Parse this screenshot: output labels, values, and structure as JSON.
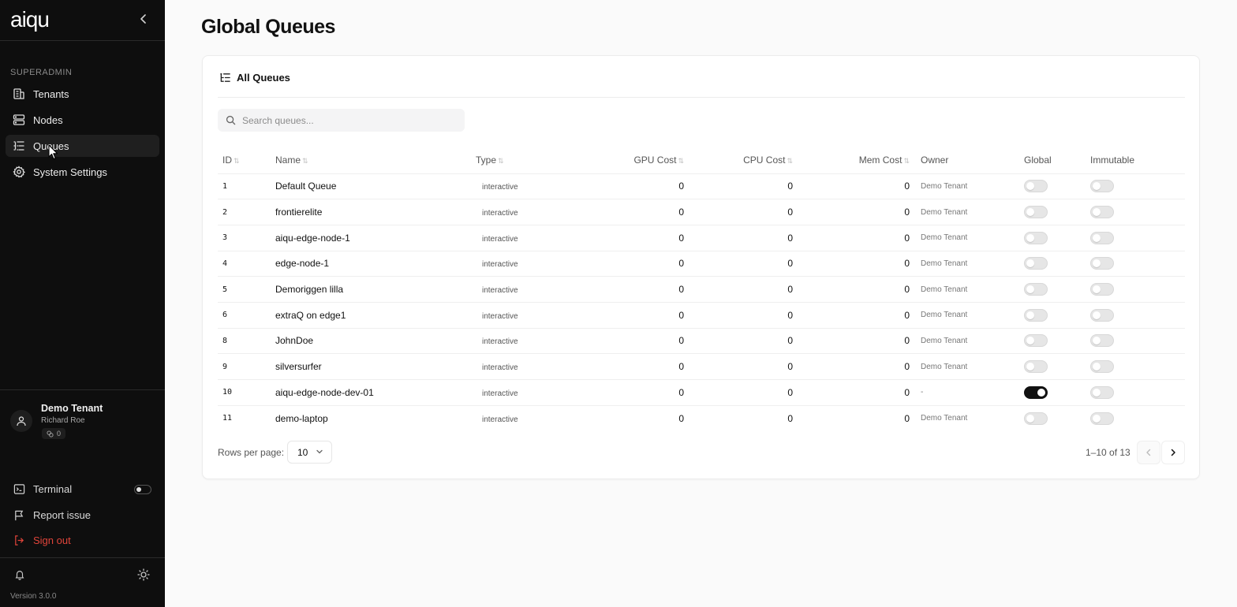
{
  "sidebar": {
    "logo": "aiqu",
    "section_label": "SUPERADMIN",
    "items": [
      {
        "label": "Tenants",
        "icon": "building-icon"
      },
      {
        "label": "Nodes",
        "icon": "server-icon"
      },
      {
        "label": "Queues",
        "icon": "list-icon",
        "active": true
      },
      {
        "label": "System Settings",
        "icon": "gear-icon"
      }
    ],
    "user": {
      "tenant": "Demo Tenant",
      "name": "Richard Roe",
      "badge": "0"
    },
    "bottom": {
      "terminal": "Terminal",
      "report": "Report issue",
      "signout": "Sign out"
    },
    "version": "Version 3.0.0"
  },
  "page": {
    "title": "Global Queues"
  },
  "card": {
    "title": "All Queues",
    "search_placeholder": "Search queues..."
  },
  "table": {
    "headers": {
      "id": "ID",
      "name": "Name",
      "type": "Type",
      "gpu": "GPU Cost",
      "cpu": "CPU Cost",
      "mem": "Mem Cost",
      "owner": "Owner",
      "global": "Global",
      "immutable": "Immutable"
    },
    "rows": [
      {
        "id": "1",
        "name": "Default Queue",
        "type": "interactive",
        "gpu": "0",
        "cpu": "0",
        "mem": "0",
        "owner": "Demo Tenant",
        "global": false,
        "immutable": false
      },
      {
        "id": "2",
        "name": "frontierelite",
        "type": "interactive",
        "gpu": "0",
        "cpu": "0",
        "mem": "0",
        "owner": "Demo Tenant",
        "global": false,
        "immutable": false
      },
      {
        "id": "3",
        "name": "aiqu-edge-node-1",
        "type": "interactive",
        "gpu": "0",
        "cpu": "0",
        "mem": "0",
        "owner": "Demo Tenant",
        "global": false,
        "immutable": false
      },
      {
        "id": "4",
        "name": "edge-node-1",
        "type": "interactive",
        "gpu": "0",
        "cpu": "0",
        "mem": "0",
        "owner": "Demo Tenant",
        "global": false,
        "immutable": false
      },
      {
        "id": "5",
        "name": "Demoriggen lilla",
        "type": "interactive",
        "gpu": "0",
        "cpu": "0",
        "mem": "0",
        "owner": "Demo Tenant",
        "global": false,
        "immutable": false
      },
      {
        "id": "6",
        "name": "extraQ on edge1",
        "type": "interactive",
        "gpu": "0",
        "cpu": "0",
        "mem": "0",
        "owner": "Demo Tenant",
        "global": false,
        "immutable": false
      },
      {
        "id": "8",
        "name": "JohnDoe",
        "type": "interactive",
        "gpu": "0",
        "cpu": "0",
        "mem": "0",
        "owner": "Demo Tenant",
        "global": false,
        "immutable": false
      },
      {
        "id": "9",
        "name": "silversurfer",
        "type": "interactive",
        "gpu": "0",
        "cpu": "0",
        "mem": "0",
        "owner": "Demo Tenant",
        "global": false,
        "immutable": false
      },
      {
        "id": "10",
        "name": "aiqu-edge-node-dev-01",
        "type": "interactive",
        "gpu": "0",
        "cpu": "0",
        "mem": "0",
        "owner": "-",
        "global": true,
        "immutable": false
      },
      {
        "id": "11",
        "name": "demo-laptop",
        "type": "interactive",
        "gpu": "0",
        "cpu": "0",
        "mem": "0",
        "owner": "Demo Tenant",
        "global": false,
        "immutable": false
      }
    ]
  },
  "pagination": {
    "rows_per_page_label": "Rows per page:",
    "rows_per_page": "10",
    "info": "1–10 of 13"
  },
  "colors": {
    "sidebar_bg": "#0e0e0e",
    "signout": "#e0443a",
    "toggle_on": "#111111"
  }
}
